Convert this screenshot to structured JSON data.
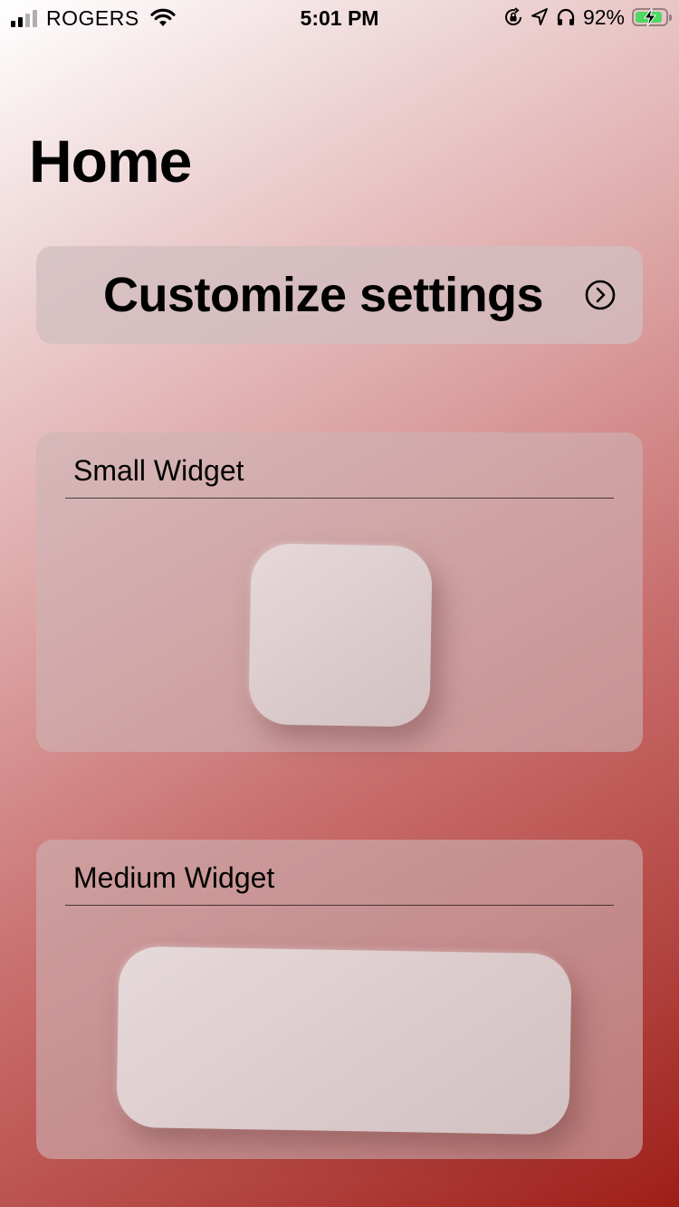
{
  "status_bar": {
    "carrier": "ROGERS",
    "time": "5:01 PM",
    "battery_percent": "92%",
    "battery_level": 0.92,
    "battery_color": "#4cd964",
    "icons": [
      "cellular-signal-icon",
      "wifi-icon",
      "orientation-lock-icon",
      "location-arrow-icon",
      "headphones-icon",
      "battery-charging-icon"
    ]
  },
  "page": {
    "title": "Home"
  },
  "customize": {
    "label": "Customize settings",
    "icon": "chevron-circle-icon"
  },
  "widgets": [
    {
      "title": "Small Widget"
    },
    {
      "title": "Medium Widget"
    }
  ],
  "theme": {
    "gradient": [
      "#ffffff",
      "#dca3a3",
      "#9e1e18"
    ]
  }
}
